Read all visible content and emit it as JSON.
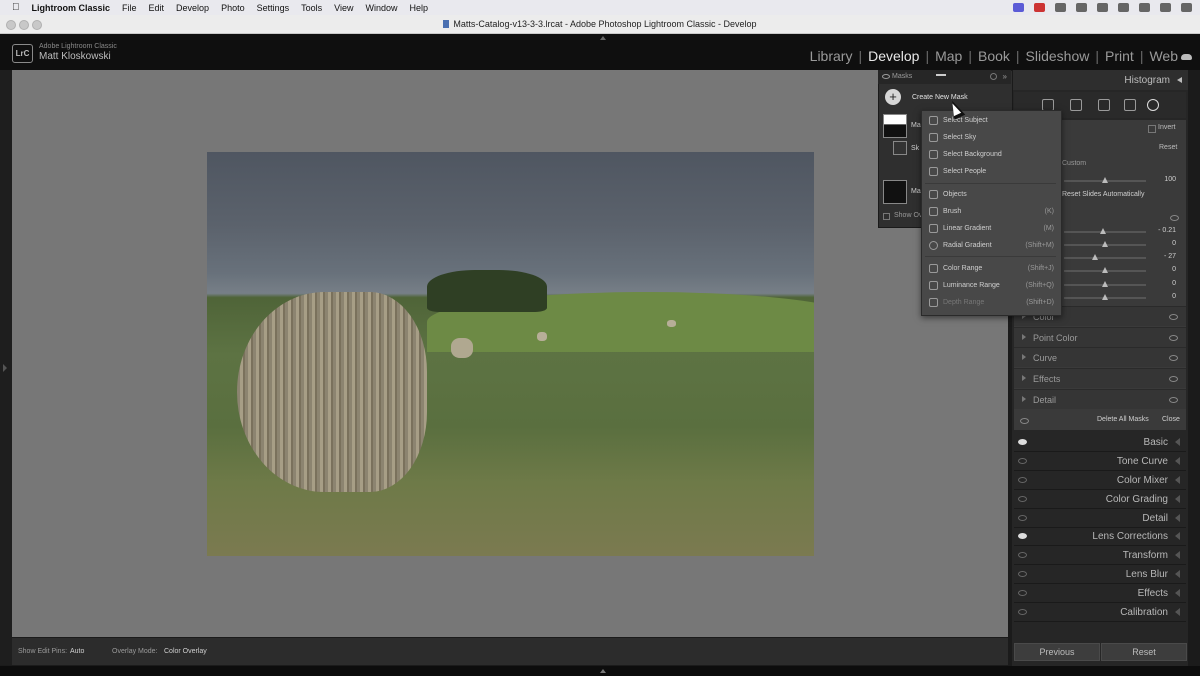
{
  "menubar": {
    "app": "Lightroom Classic",
    "items": [
      "File",
      "Edit",
      "Develop",
      "Photo",
      "Settings",
      "Tools",
      "View",
      "Window",
      "Help"
    ]
  },
  "window": {
    "title": "Matts-Catalog-v13-3-3.lrcat - Adobe Photoshop Lightroom Classic - Develop"
  },
  "brand": {
    "logo": "LrC",
    "product": "Adobe Lightroom Classic",
    "user": "Matt Kloskowski"
  },
  "modules": [
    "Library",
    "Develop",
    "Map",
    "Book",
    "Slideshow",
    "Print",
    "Web"
  ],
  "active_module": "Develop",
  "right_panel": {
    "histogram": "Histogram",
    "invert": "Invert",
    "reset": "Reset",
    "amount_preset": "Custom",
    "amount_value": "100",
    "reset_sliders": "Reset Slides Automatically",
    "slider_values": [
      "- 0.21",
      "0",
      "- 27",
      "0",
      "0",
      "0",
      "0"
    ],
    "mask_sections": [
      "Color",
      "Point Color",
      "Curve",
      "Effects",
      "Detail"
    ],
    "delete_all": "Delete All Masks",
    "close": "Close",
    "sections": [
      "Basic",
      "Tone Curve",
      "Color Mixer",
      "Color Grading",
      "Detail",
      "Lens Corrections",
      "Transform",
      "Lens Blur",
      "Effects",
      "Calibration"
    ],
    "previous": "Previous",
    "reset_button": "Reset"
  },
  "masks_panel": {
    "title": "Masks",
    "create_new": "Create New Mask",
    "mask_name_1": "Ma",
    "mask_sub": "Sk",
    "mask_name_2": "Ma",
    "show_overlay": "Show Ov"
  },
  "dropdown": {
    "items": [
      {
        "label": "Select Subject",
        "key": ""
      },
      {
        "label": "Select Sky",
        "key": ""
      },
      {
        "label": "Select Background",
        "key": ""
      },
      {
        "label": "Select People",
        "key": ""
      },
      {
        "label": "Objects",
        "key": ""
      },
      {
        "label": "Brush",
        "key": "(K)"
      },
      {
        "label": "Linear Gradient",
        "key": "(M)"
      },
      {
        "label": "Radial Gradient",
        "key": "(Shift+M)"
      },
      {
        "label": "Color Range",
        "key": "(Shift+J)"
      },
      {
        "label": "Luminance Range",
        "key": "(Shift+Q)"
      },
      {
        "label": "Depth Range",
        "key": "(Shift+D)"
      }
    ]
  },
  "bottom_toolbar": {
    "edit_pins_label": "Show Edit Pins:",
    "edit_pins_value": "Auto",
    "overlay_label": "Overlay Mode:",
    "overlay_value": "Color Overlay"
  }
}
